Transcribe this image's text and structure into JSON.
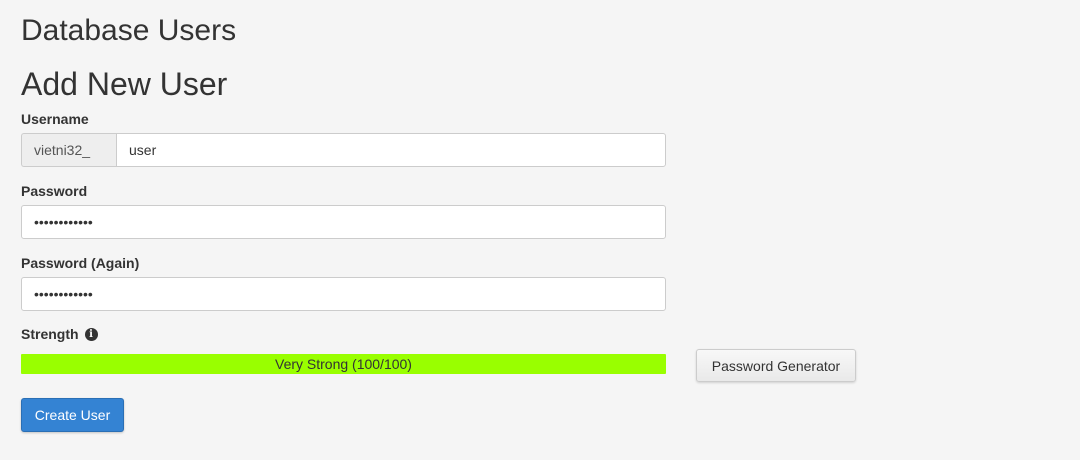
{
  "page": {
    "title": "Database Users",
    "section_title": "Add New User"
  },
  "form": {
    "username": {
      "label": "Username",
      "prefix": "vietni32_",
      "value": "user"
    },
    "password": {
      "label": "Password",
      "value": "••••••••••••"
    },
    "password_again": {
      "label": "Password (Again)",
      "value": "••••••••••••"
    },
    "strength": {
      "label": "Strength",
      "info_icon": "info-circle-icon",
      "text": "Very Strong (100/100)",
      "score": 100,
      "max": 100,
      "bar_color": "#99ff00"
    },
    "password_generator_label": "Password Generator",
    "submit_label": "Create User"
  },
  "colors": {
    "primary_button": "#3483d3",
    "strength_fill": "#99ff00"
  }
}
